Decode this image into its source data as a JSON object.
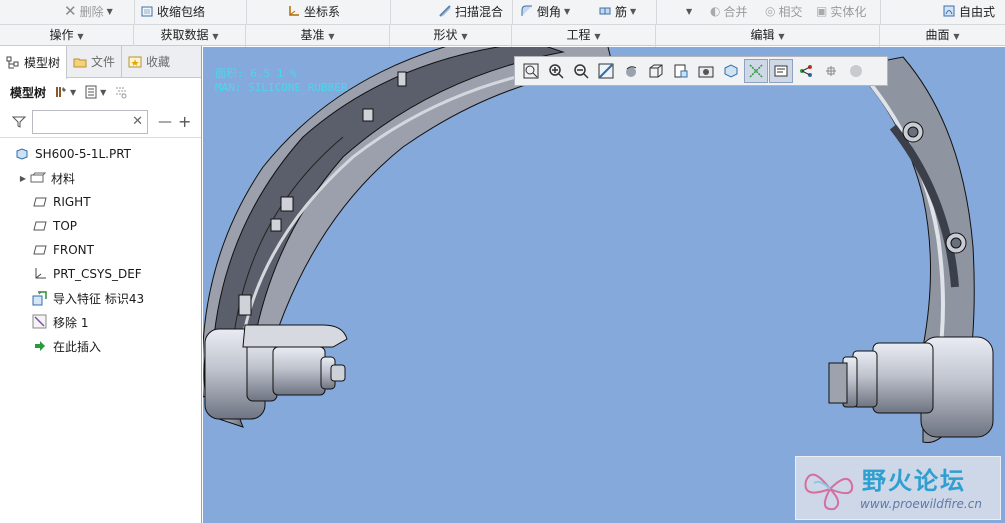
{
  "ribbon": {
    "row": {
      "delete": "删除",
      "shrinkwrap": "收缩包络",
      "csys": "坐标系",
      "swept_blend": "扫描混合",
      "round": "倒角",
      "rib": "筋",
      "merge": "合并",
      "intersect": "相交",
      "solidify": "实体化",
      "freestyle": "自由式"
    },
    "groups": {
      "operations": "操作",
      "get_data": "获取数据",
      "datum": "基准",
      "shapes": "形状",
      "engineering": "工程",
      "editing": "编辑",
      "surfaces": "曲面"
    }
  },
  "left_panel": {
    "tabs": [
      "模型树",
      "文件",
      "收藏"
    ],
    "toolbar_title": "模型树",
    "filter_placeholder": "",
    "tree": [
      {
        "label": "SH600-5-1L.PRT",
        "icon": "part-icon"
      },
      {
        "label": "材料",
        "icon": "material-icon",
        "expandable": true
      },
      {
        "label": "RIGHT",
        "icon": "datum-plane-icon"
      },
      {
        "label": "TOP",
        "icon": "datum-plane-icon"
      },
      {
        "label": "FRONT",
        "icon": "datum-plane-icon"
      },
      {
        "label": "PRT_CSYS_DEF",
        "icon": "csys-icon"
      },
      {
        "label": "导入特征 标识43",
        "icon": "import-feature-icon"
      },
      {
        "label": "移除 1",
        "icon": "remove-icon"
      },
      {
        "label": "在此插入",
        "icon": "insert-here-icon"
      }
    ]
  },
  "viewport": {
    "info_line1": "面积: 6.5 1 %",
    "info_line2": "MAN: SILICONE_RUBBER",
    "background": "#84a9da"
  },
  "watermark": {
    "title": "野火论坛",
    "url": "www.proewildfire.cn"
  }
}
